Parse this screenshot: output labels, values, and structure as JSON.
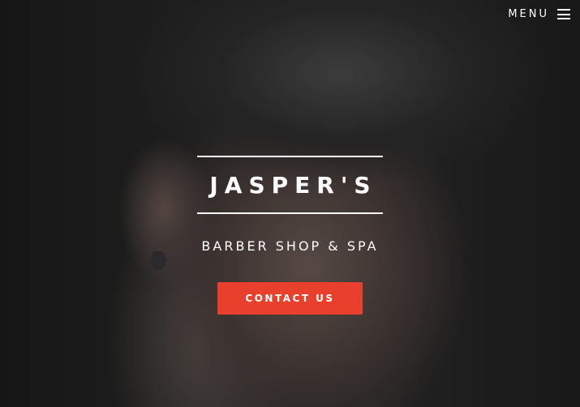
{
  "nav": {
    "menu_label": "MENU",
    "menu_icon": "hamburger-icon"
  },
  "hero": {
    "title": "JASPER'S",
    "subtitle": "BARBER SHOP & SPA",
    "cta_label": "CONTACT US"
  },
  "colors": {
    "accent": "#e8402d",
    "text": "#ffffff"
  }
}
